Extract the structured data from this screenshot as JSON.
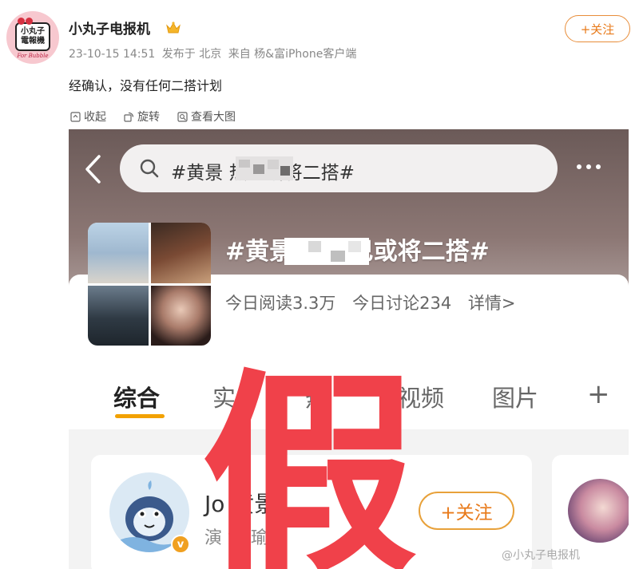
{
  "post": {
    "username": "小丸子电报机",
    "avatar_text_line1": "小丸子",
    "avatar_text_line2": "電報機",
    "avatar_foot": "For Bubble",
    "timestamp": "23-10-15 14:51",
    "location": "发布于 北京",
    "source": "来自 杨&富iPhone客户端",
    "follow_label": "+关注",
    "text": "经确认，没有任何二搭计划"
  },
  "toolbar": {
    "collapse_label": "收起",
    "rotate_label": "旋转",
    "view_large_label": "查看大图"
  },
  "screenshot": {
    "search_text": "#黄景      热巴或将二搭#",
    "topic_title": "#黄景          丽热巴或将二搭#",
    "stats": {
      "reads": "今日阅读3.3万",
      "discussions": "今日讨论234",
      "details": "详情>"
    },
    "tabs": [
      "综合",
      "实",
      "热",
      "视频",
      "图片"
    ],
    "tab_plus": "+",
    "user_card": {
      "name": "Jo    黄景",
      "subtitle": "演    黄   瑜",
      "follow_label": "+关注",
      "verified_badge": "v"
    },
    "fake_stamp": "假"
  },
  "watermark": "@小丸子电报机",
  "colors": {
    "accent": "#e87a1a",
    "stamp": "#f0414a",
    "tab_underline": "#f2a100"
  },
  "icons": [
    "crown-icon",
    "collapse-icon",
    "rotate-icon",
    "view-large-icon",
    "back-icon",
    "search-icon",
    "more-icon",
    "plus-icon"
  ]
}
